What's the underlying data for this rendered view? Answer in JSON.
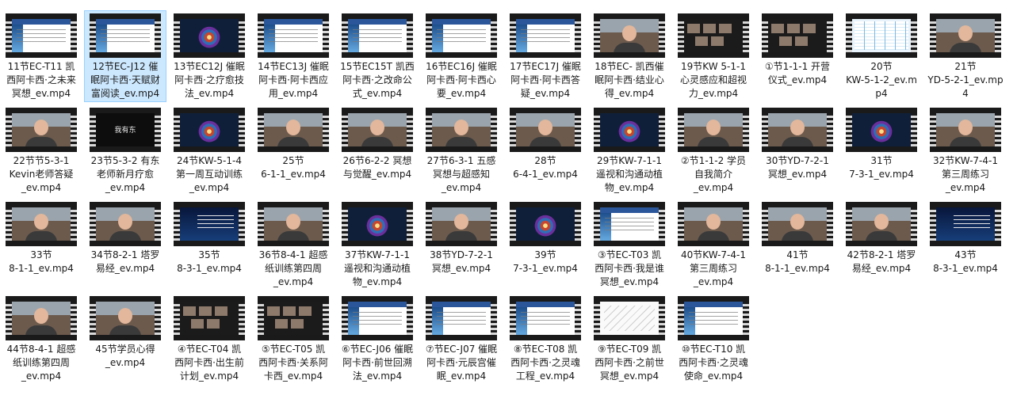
{
  "files": [
    {
      "name": "11节EC-T11 凯西阿卡西·之未来冥想_ev.mp4",
      "thumb": "slide",
      "lines": [
        "11节EC-T11 凯",
        "西阿卡西·之未来",
        "冥想_ev.mp4"
      ]
    },
    {
      "name": "12节EC-J12 催眠阿卡西·天赋财富阅读_ev.mp4",
      "thumb": "slide",
      "selected": true,
      "lines": [
        "12节EC-J12 催",
        "眠阿卡西·天赋财",
        "富阅读_ev.mp4"
      ]
    },
    {
      "name": "13节EC12J 催眠阿卡西·之疗愈技法_ev.mp4",
      "thumb": "mandala",
      "lines": [
        "13节EC12J 催眠",
        "阿卡西·之疗愈技",
        "法_ev.mp4"
      ]
    },
    {
      "name": "14节EC13J 催眠阿卡西·阿卡西应用_ev.mp4",
      "thumb": "slide",
      "lines": [
        "14节EC13J 催眠",
        "阿卡西·阿卡西应",
        "用_ev.mp4"
      ]
    },
    {
      "name": "15节EC15T 凯西阿卡西·之改命公式_ev.mp4",
      "thumb": "slide",
      "lines": [
        "15节EC15T 凯西",
        "阿卡西·之改命公",
        "式_ev.mp4"
      ]
    },
    {
      "name": "16节EC16J 催眠阿卡西·阿卡西心要_ev.mp4",
      "thumb": "slide",
      "lines": [
        "16节EC16J 催眠",
        "阿卡西·阿卡西心",
        "要_ev.mp4"
      ]
    },
    {
      "name": "17节EC17J 催眠阿卡西·阿卡西答疑_ev.mp4",
      "thumb": "slide",
      "lines": [
        "17节EC17J 催眠",
        "阿卡西·阿卡西答",
        "疑_ev.mp4"
      ]
    },
    {
      "name": "18节EC- 凯西催眠阿卡西·结业心得_ev.mp4",
      "thumb": "person",
      "lines": [
        "18节EC- 凯西催",
        "眠阿卡西·结业心",
        "得_ev.mp4"
      ]
    },
    {
      "name": "19节KW 5-1-1 心灵感应和超视力_ev.mp4",
      "thumb": "group",
      "lines": [
        "19节KW 5-1-1",
        "心灵感应和超视",
        "力_ev.mp4"
      ]
    },
    {
      "name": "①节1-1-1 开营仪式_ev.mp4",
      "thumb": "group",
      "lines": [
        "①节1-1-1 开营",
        "仪式_ev.mp4"
      ]
    },
    {
      "name": "20节KW-5-1-2_ev.mp4",
      "thumb": "table",
      "lines": [
        "20节",
        "KW-5-1-2_ev.m",
        "p4"
      ]
    },
    {
      "name": "21节YD-5-2-1_ev.mp4",
      "thumb": "person",
      "lines": [
        "21节",
        "YD-5-2-1_ev.mp",
        "4"
      ]
    },
    {
      "name": "22节节5-3-1 Kevin老师答疑_ev.mp4",
      "thumb": "person",
      "lines": [
        "22节节5-3-1",
        "Kevin老师答疑",
        "_ev.mp4"
      ]
    },
    {
      "name": "23节5-3-2 有东老师新月疗愈_ev.mp4",
      "thumb": "dark",
      "screenText": "我有东",
      "lines": [
        "23节5-3-2 有东",
        "老师新月疗愈",
        "_ev.mp4"
      ]
    },
    {
      "name": "24节KW-5-1-4 第一周互动训练_ev.mp4",
      "thumb": "mandala",
      "lines": [
        "24节KW-5-1-4",
        "第一周互动训练",
        "_ev.mp4"
      ]
    },
    {
      "name": "25节6-1-1_ev.mp4",
      "thumb": "person",
      "lines": [
        "25节",
        "6-1-1_ev.mp4"
      ]
    },
    {
      "name": "26节6-2-2 冥想与觉醒_ev.mp4",
      "thumb": "person",
      "lines": [
        "26节6-2-2 冥想",
        "与觉醒_ev.mp4"
      ]
    },
    {
      "name": "27节6-3-1 五感冥想与超感知_ev.mp4",
      "thumb": "person",
      "lines": [
        "27节6-3-1 五感",
        "冥想与超感知",
        "_ev.mp4"
      ]
    },
    {
      "name": "28节6-4-1_ev.mp4",
      "thumb": "person",
      "lines": [
        "28节",
        "6-4-1_ev.mp4"
      ]
    },
    {
      "name": "29节KW-7-1-1 遥视和沟通动植物_ev.mp4",
      "thumb": "mandala",
      "lines": [
        "29节KW-7-1-1",
        "遥视和沟通动植",
        "物_ev.mp4"
      ]
    },
    {
      "name": "②节1-1-2 学员自我简介_ev.mp4",
      "thumb": "person",
      "lines": [
        "②节1-1-2 学员",
        "自我简介",
        "_ev.mp4"
      ]
    },
    {
      "name": "30节YD-7-2-1 冥想_ev.mp4",
      "thumb": "person",
      "lines": [
        "30节YD-7-2-1",
        "冥想_ev.mp4"
      ]
    },
    {
      "name": "31节7-3-1_ev.mp4",
      "thumb": "mandala",
      "lines": [
        "31节",
        "7-3-1_ev.mp4"
      ]
    },
    {
      "name": "32节KW-7-4-1 第三周练习_ev.mp4",
      "thumb": "person",
      "lines": [
        "32节KW-7-4-1",
        "第三周练习",
        "_ev.mp4"
      ]
    },
    {
      "name": "33节8-1-1_ev.mp4",
      "thumb": "person",
      "lines": [
        "33节",
        "8-1-1_ev.mp4"
      ]
    },
    {
      "name": "34节8-2-1 塔罗易经_ev.mp4",
      "thumb": "person",
      "lines": [
        "34节8-2-1 塔罗",
        "易经_ev.mp4"
      ]
    },
    {
      "name": "35节8-3-1_ev.mp4",
      "thumb": "stars",
      "lines": [
        "35节",
        "8-3-1_ev.mp4"
      ]
    },
    {
      "name": "36节8-4-1 超感纸训练第四周_ev.mp4",
      "thumb": "person",
      "lines": [
        "36节8-4-1 超感",
        "纸训练第四周",
        "_ev.mp4"
      ]
    },
    {
      "name": "37节KW-7-1-1 遥视和沟通动植物_ev.mp4",
      "thumb": "mandala",
      "lines": [
        "37节KW-7-1-1",
        "遥视和沟通动植",
        "物_ev.mp4"
      ]
    },
    {
      "name": "38节YD-7-2-1 冥想_ev.mp4",
      "thumb": "person",
      "lines": [
        "38节YD-7-2-1",
        "冥想_ev.mp4"
      ]
    },
    {
      "name": "39节7-3-1_ev.mp4",
      "thumb": "mandala",
      "lines": [
        "39节",
        "7-3-1_ev.mp4"
      ]
    },
    {
      "name": "③节EC-T03 凯西阿卡西·我是谁冥想_ev.mp4",
      "thumb": "slide",
      "lines": [
        "③节EC-T03 凯",
        "西阿卡西·我是谁",
        "冥想_ev.mp4"
      ]
    },
    {
      "name": "40节KW-7-4-1 第三周练习_ev.mp4",
      "thumb": "person",
      "lines": [
        "40节KW-7-4-1",
        "第三周练习",
        "_ev.mp4"
      ]
    },
    {
      "name": "41节8-1-1_ev.mp4",
      "thumb": "person",
      "lines": [
        "41节",
        "8-1-1_ev.mp4"
      ]
    },
    {
      "name": "42节8-2-1 塔罗易经_ev.mp4",
      "thumb": "person",
      "lines": [
        "42节8-2-1 塔罗",
        "易经_ev.mp4"
      ]
    },
    {
      "name": "43节8-3-1_ev.mp4",
      "thumb": "stars",
      "lines": [
        "43节",
        "8-3-1_ev.mp4"
      ]
    },
    {
      "name": "44节8-4-1 超感纸训练第四周_ev.mp4",
      "thumb": "person",
      "lines": [
        "44节8-4-1 超感",
        "纸训练第四周",
        "_ev.mp4"
      ]
    },
    {
      "name": "45节学员心得_ev.mp4",
      "thumb": "person",
      "lines": [
        "45节学员心得",
        "_ev.mp4"
      ]
    },
    {
      "name": "④节EC-T04 凯西阿卡西·出生前计划_ev.mp4",
      "thumb": "group",
      "lines": [
        "④节EC-T04 凯",
        "西阿卡西·出生前",
        "计划_ev.mp4"
      ]
    },
    {
      "name": "⑤节EC-T05 凯西阿卡西·关系阿卡西_ev.mp4",
      "thumb": "group",
      "lines": [
        "⑤节EC-T05 凯",
        "西阿卡西·关系阿",
        "卡西_ev.mp4"
      ]
    },
    {
      "name": "⑥节EC-J06 催眠阿卡西·前世回溯法_ev.mp4",
      "thumb": "slide",
      "lines": [
        "⑥节EC-J06 催眠",
        "阿卡西·前世回溯",
        "法_ev.mp4"
      ]
    },
    {
      "name": "⑦节EC-J07 催眠阿卡西·元辰宫催眠_ev.mp4",
      "thumb": "slide",
      "lines": [
        "⑦节EC-J07 催眠",
        "阿卡西·元辰宫催",
        "眠_ev.mp4"
      ]
    },
    {
      "name": "⑧节EC-T08 凯西阿卡西·之灵魂工程_ev.mp4",
      "thumb": "slide",
      "lines": [
        "⑧节EC-T08 凯",
        "西阿卡西·之灵魂",
        "工程_ev.mp4"
      ]
    },
    {
      "name": "⑨节EC-T09 凯西阿卡西·之前世冥想_ev.mp4",
      "thumb": "sketch",
      "lines": [
        "⑨节EC-T09 凯",
        "西阿卡西·之前世",
        "冥想_ev.mp4"
      ]
    },
    {
      "name": "⑩节EC-T10 凯西阿卡西·之灵魂使命_ev.mp4",
      "thumb": "slide",
      "lines": [
        "⑩节EC-T10 凯",
        "西阿卡西·之灵魂",
        "使命_ev.mp4"
      ]
    }
  ],
  "colors": {
    "selection_bg": "#cce8ff",
    "selection_border": "#99d1ff",
    "label_text": "#1a1a1a"
  }
}
